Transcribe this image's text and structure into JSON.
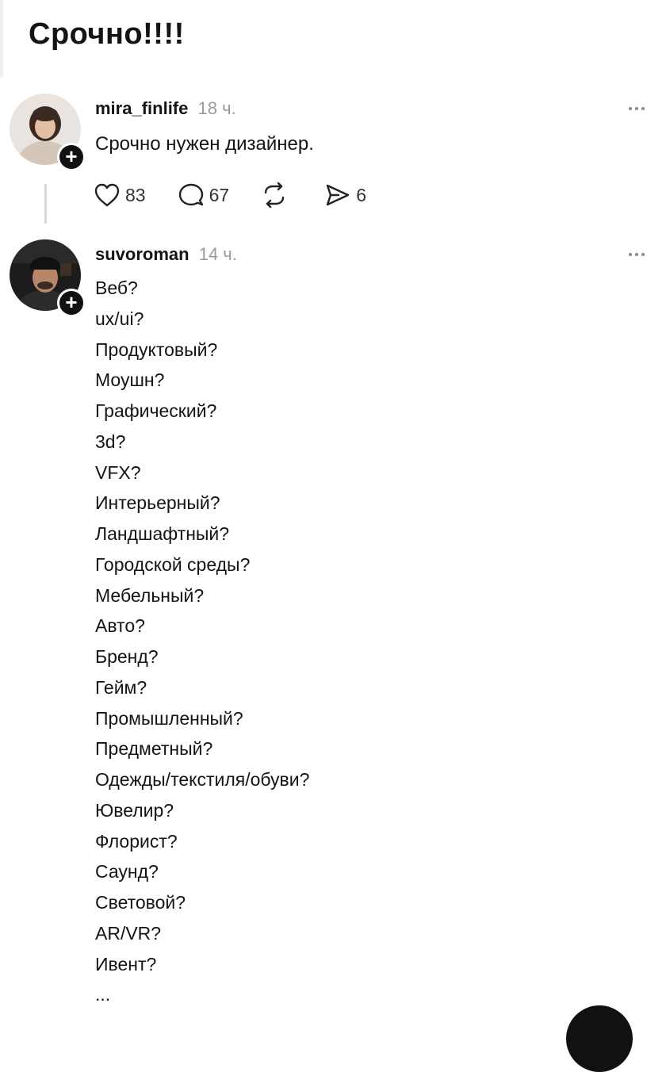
{
  "header": {
    "title": "Срочно!!!!"
  },
  "posts": [
    {
      "username": "mira_finlife",
      "time": "18 ч.",
      "text": "Срочно нужен дизайнер.",
      "actions": {
        "likes": "83",
        "comments": "67",
        "reposts": "",
        "shares": "6"
      },
      "follow_symbol": "+"
    },
    {
      "username": "suvoroman",
      "time": "14 ч.",
      "follow_symbol": "+",
      "lines": [
        "Веб?",
        "ux/ui?",
        "Продуктовый?",
        "Моушн?",
        "Графический?",
        "3d?",
        "VFX?",
        "Интерьерный?",
        "Ландшафтный?",
        "Городской среды?",
        "Мебельный?",
        "Авто?",
        "Бренд?",
        "Гейм?",
        "Промышленный?",
        "Предметный?",
        "Одежды/текстиля/обуви?",
        "Ювелир?",
        "Флорист?",
        "Саунд?",
        "Световой?",
        "AR/VR?",
        "Ивент?",
        "..."
      ]
    }
  ],
  "icons": {
    "like": "heart-icon",
    "comment": "comment-icon",
    "repost": "repost-icon",
    "share": "send-icon",
    "more": "more-icon",
    "follow": "plus-icon"
  },
  "colors": {
    "text": "#141414",
    "muted": "#9a9a9a",
    "background": "#ffffff",
    "badge": "#111111"
  }
}
